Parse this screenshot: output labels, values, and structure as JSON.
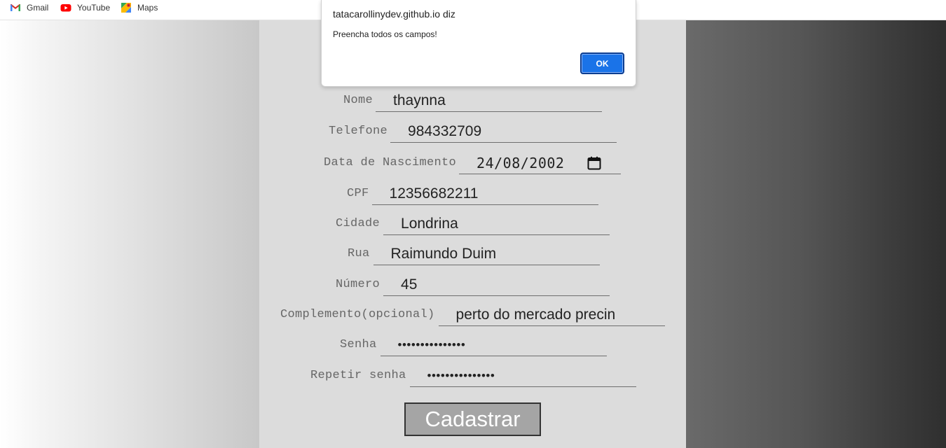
{
  "bookmarks": [
    {
      "label": "Gmail",
      "icon": "gmail-icon"
    },
    {
      "label": "YouTube",
      "icon": "youtube-icon"
    },
    {
      "label": "Maps",
      "icon": "maps-icon"
    }
  ],
  "dialog": {
    "title": "tatacarollinydev.github.io diz",
    "message": "Preencha todos os campos!",
    "ok_label": "OK"
  },
  "form": {
    "fields": [
      {
        "label": "Nome",
        "value": "thaynna"
      },
      {
        "label": "Telefone",
        "value": "984332709"
      },
      {
        "label": "Data de Nascimento",
        "value": "24/08/2002"
      },
      {
        "label": "CPF",
        "value": "12356682211"
      },
      {
        "label": "Cidade",
        "value": "Londrina"
      },
      {
        "label": "Rua",
        "value": "Raimundo Duim"
      },
      {
        "label": "Número",
        "value": "45"
      },
      {
        "label": "Complemento(opcional)",
        "value": "perto do mercado precin"
      },
      {
        "label": "Senha",
        "value": "•••••••••••••••"
      },
      {
        "label": "Repetir senha",
        "value": "•••••••••••••••"
      }
    ],
    "submit_label": "Cadastrar"
  },
  "colors": {
    "panel": "#dcdcdc",
    "accent_button": "#1a73e8",
    "submit_bg": "#a5a5a5"
  }
}
